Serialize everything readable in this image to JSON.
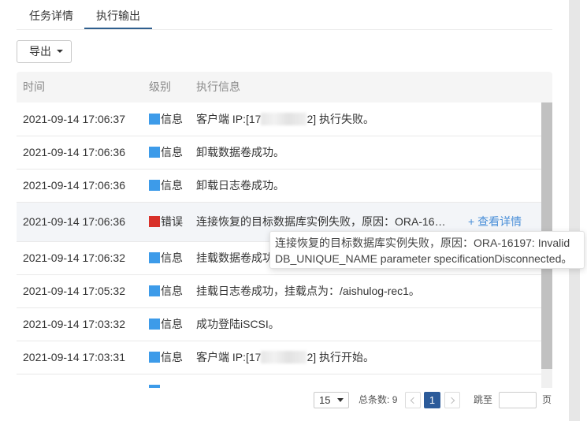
{
  "tabs": {
    "task_detail": "任务详情",
    "exec_output": "执行输出"
  },
  "toolbar": {
    "export_label": "导出",
    "export_caret_icon": "caret-down-icon"
  },
  "table": {
    "columns": {
      "time": "时间",
      "level": "级别",
      "message": "执行信息"
    },
    "rows": [
      {
        "time": "2021-09-14 17:06:37",
        "level": "信息",
        "level_color": "#3d9be9",
        "message_prefix": "客户端 IP:[17",
        "message_suffix": "2] 执行失败。"
      },
      {
        "time": "2021-09-14 17:06:36",
        "level": "信息",
        "level_color": "#3d9be9",
        "message": "卸载数据卷成功。"
      },
      {
        "time": "2021-09-14 17:06:36",
        "level": "信息",
        "level_color": "#3d9be9",
        "message": "卸载日志卷成功。"
      },
      {
        "time": "2021-09-14 17:06:36",
        "level": "错误",
        "level_color": "#d8312a",
        "message": "连接恢复的目标数据库实例失败，原因：ORA-16…",
        "detail_link": "+ 查看详情"
      },
      {
        "time": "2021-09-14 17:06:32",
        "level": "信息",
        "level_color": "#3d9be9",
        "message": "挂载数据卷成功"
      },
      {
        "time": "2021-09-14 17:05:32",
        "level": "信息",
        "level_color": "#3d9be9",
        "message": "挂载日志卷成功，挂载点为：/aishulog-rec1。"
      },
      {
        "time": "2021-09-14 17:03:32",
        "level": "信息",
        "level_color": "#3d9be9",
        "message": "成功登陆iSCSI。"
      },
      {
        "time": "2021-09-14 17:03:31",
        "level": "信息",
        "level_color": "#3d9be9",
        "message_prefix": "客户端 IP:[17",
        "message_suffix": "2] 执行开始。"
      }
    ],
    "partial_row_level_color": "#3d9be9"
  },
  "tooltip": {
    "line1": "连接恢复的目标数据库实例失败，原因：ORA-16197: Invalid",
    "line2": "DB_UNIQUE_NAME parameter specificationDisconnected。"
  },
  "pagination": {
    "page_size": "15",
    "page_size_caret_icon": "caret-down-icon",
    "total_label": "总条数:",
    "total": 9,
    "prev_icon": "chevron-left-icon",
    "current_page": "1",
    "next_icon": "chevron-right-icon",
    "jump_label": "跳至",
    "jump_value": "",
    "page_unit": "页"
  },
  "colors": {
    "accent": "#2c5b9a",
    "tab_indicator": "#2f5f8e",
    "info": "#3d9be9",
    "error": "#d8312a",
    "link": "#4a8fd8"
  }
}
